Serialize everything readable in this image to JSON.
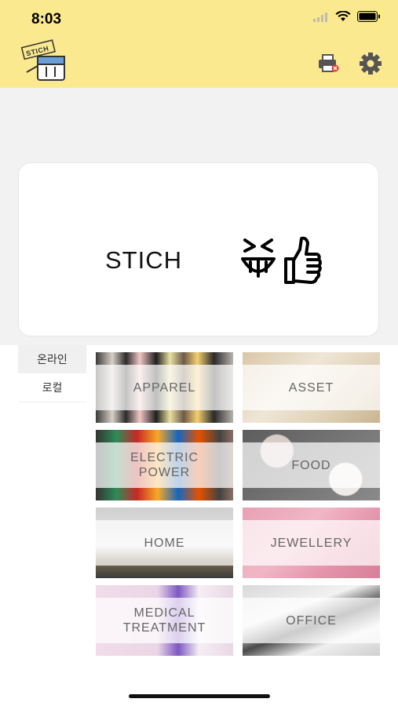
{
  "status_bar": {
    "time": "8:03"
  },
  "header": {
    "logo_text": "STICH",
    "printer_icon": "printer-icon",
    "settings_icon": "gear-icon"
  },
  "banner": {
    "text": "STICH",
    "emoji_icon": "laughing-thumbs-up-icon"
  },
  "side_tabs": [
    {
      "label": "온라인",
      "active": true
    },
    {
      "label": "로컬",
      "active": false
    }
  ],
  "categories": [
    {
      "label": "APPAREL"
    },
    {
      "label": "ASSET"
    },
    {
      "label": "ELECTRIC POWER"
    },
    {
      "label": "FOOD"
    },
    {
      "label": "HOME"
    },
    {
      "label": "JEWELLERY"
    },
    {
      "label": "MEDICAL TREATMENT"
    },
    {
      "label": "OFFICE"
    }
  ],
  "colors": {
    "header_bg": "#fbe98f",
    "accent_red": "#e53935"
  }
}
